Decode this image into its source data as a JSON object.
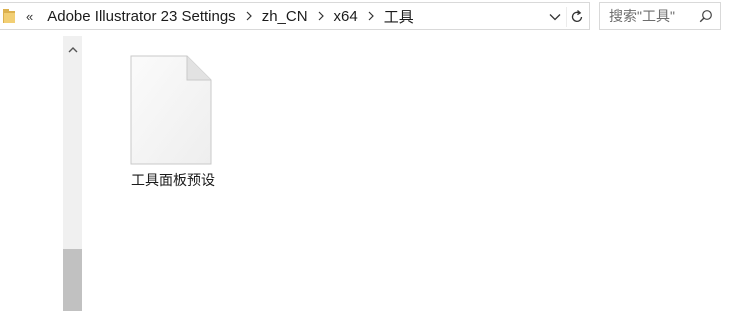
{
  "address_bar": {
    "overflow_label": "«",
    "crumbs": [
      "Adobe Illustrator 23 Settings",
      "zh_CN",
      "x64",
      "工具"
    ]
  },
  "search": {
    "placeholder": "搜索\"工具\""
  },
  "files": [
    {
      "name": "工具面板预设",
      "type": "file"
    }
  ],
  "colors": {
    "scrollbar_track": "#f0f0f0",
    "scrollbar_thumb": "#c1c1c1",
    "border": "#d9d9d9",
    "folder": "#e8c26b"
  }
}
